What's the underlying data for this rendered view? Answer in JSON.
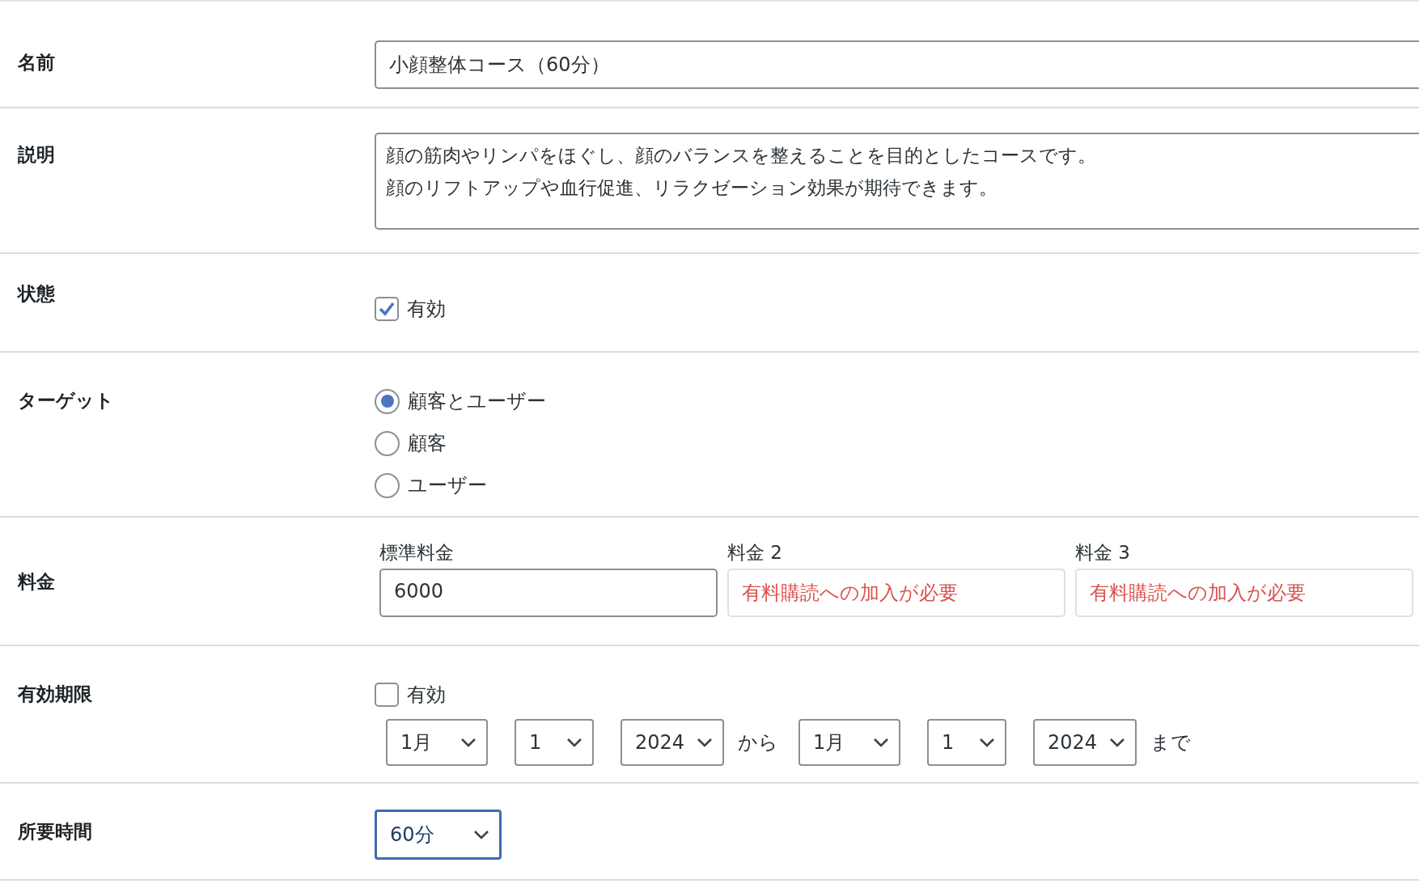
{
  "rows": [
    {
      "kind": "text",
      "label": "名前",
      "value": "小顔整体コース（60分）"
    },
    {
      "kind": "textarea",
      "label": "説明",
      "lines": [
        "顔の筋肉やリンパをほぐし、顔のバランスを整えることを目的としたコースです。",
        "顔のリフトアップや血行促進、リラクゼーション効果が期待できます。"
      ]
    },
    {
      "kind": "checkbox",
      "label": "状態",
      "option": {
        "label": "有効",
        "checked": true
      }
    },
    {
      "kind": "radio",
      "label": "ターゲット",
      "options": [
        {
          "label": "顧客とユーザー",
          "selected": true
        },
        {
          "label": "顧客",
          "selected": false
        },
        {
          "label": "ユーザー",
          "selected": false
        }
      ]
    },
    {
      "kind": "prices",
      "label": "料金",
      "prices": [
        {
          "label": "標準料金",
          "value": "6000",
          "disabled": false
        },
        {
          "label": "料金 2",
          "value": "有料購読への加入が必要",
          "disabled": true
        },
        {
          "label": "料金 3",
          "value": "有料購読への加入が必要",
          "disabled": true
        }
      ]
    },
    {
      "kind": "date_range",
      "label": "有効期限",
      "option": {
        "label": "有効",
        "checked": false
      },
      "from": [
        "1月",
        "1",
        "2024"
      ],
      "from_suffix": "から",
      "to": [
        "1月",
        "1",
        "2024"
      ],
      "to_suffix": "まで"
    },
    {
      "kind": "select",
      "label": "所要時間",
      "value": "60分",
      "focused": true
    }
  ]
}
